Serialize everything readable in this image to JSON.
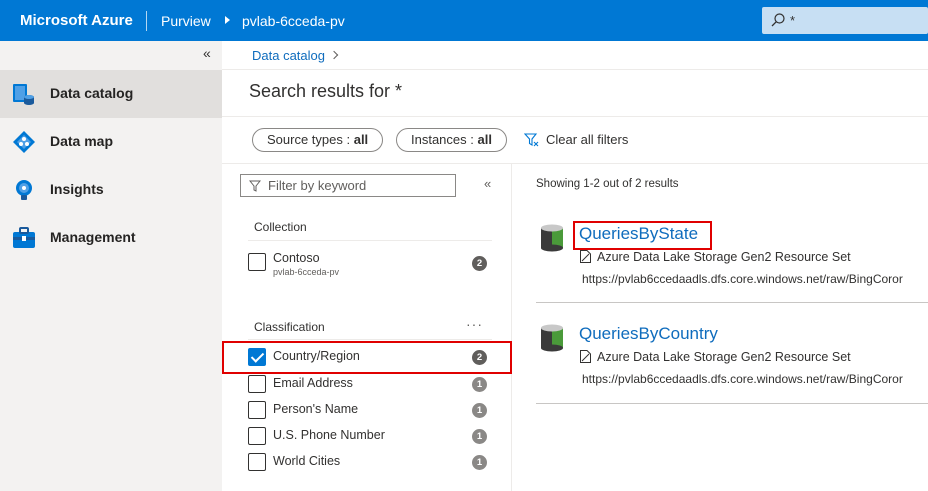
{
  "header": {
    "brand": "Microsoft Azure",
    "service": "Purview",
    "account": "pvlab-6cceda-pv",
    "search_value": "*"
  },
  "nav": {
    "collapse_glyph": "«",
    "items": [
      {
        "label": "Data catalog",
        "icon": "data-catalog-icon",
        "active": true
      },
      {
        "label": "Data map",
        "icon": "data-map-icon",
        "active": false
      },
      {
        "label": "Insights",
        "icon": "insights-icon",
        "active": false
      },
      {
        "label": "Management",
        "icon": "management-icon",
        "active": false
      }
    ]
  },
  "breadcrumb": {
    "item": "Data catalog"
  },
  "page": {
    "title": "Search results for *"
  },
  "filters": {
    "source_types_label": "Source types : ",
    "source_types_value": "all",
    "instances_label": "Instances : ",
    "instances_value": "all",
    "clear_label": "Clear all filters"
  },
  "panel": {
    "keyword_placeholder": "Filter by keyword",
    "collapse_glyph": "«",
    "collection": {
      "title": "Collection",
      "items": [
        {
          "label": "Contoso",
          "sublabel": "pvlab-6cceda-pv",
          "count": "2",
          "checked": false
        }
      ]
    },
    "classification": {
      "title": "Classification",
      "more": "···",
      "items": [
        {
          "label": "Country/Region",
          "count": "2",
          "checked": true
        },
        {
          "label": "Email Address",
          "count": "1",
          "checked": false
        },
        {
          "label": "Person's Name",
          "count": "1",
          "checked": false
        },
        {
          "label": "U.S. Phone Number",
          "count": "1",
          "checked": false
        },
        {
          "label": "World Cities",
          "count": "1",
          "checked": false
        }
      ]
    }
  },
  "results": {
    "summary": "Showing 1-2 out of 2 results",
    "items": [
      {
        "title": "QueriesByState",
        "type": "Azure Data Lake Storage Gen2 Resource Set",
        "url": "https://pvlab6ccedaadls.dfs.core.windows.net/raw/BingCoror"
      },
      {
        "title": "QueriesByCountry",
        "type": "Azure Data Lake Storage Gen2 Resource Set",
        "url": "https://pvlab6ccedaadls.dfs.core.windows.net/raw/BingCoror"
      }
    ]
  },
  "colors": {
    "brand_blue": "#0078d4",
    "link": "#0f6cbd",
    "highlight": "#e00000"
  }
}
